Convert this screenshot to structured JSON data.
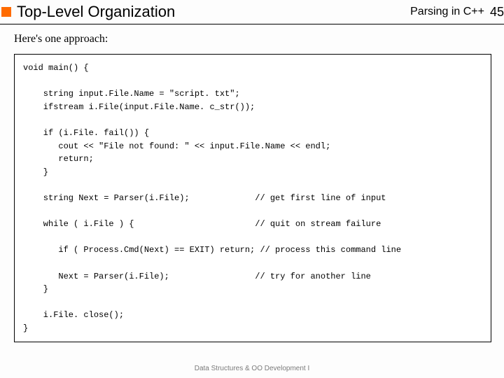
{
  "header": {
    "title": "Top-Level Organization",
    "subtitle": "Parsing in C++",
    "page": "45"
  },
  "intro": "Here's one approach:",
  "code": "void main() {\n\n    string input.File.Name = \"script. txt\";\n    ifstream i.File(input.File.Name. c_str());\n\n    if (i.File. fail()) {\n       cout << \"File not found: \" << input.File.Name << endl;\n       return;\n    }\n\n    string Next = Parser(i.File);             // get first line of input\n\n    while ( i.File ) {                        // quit on stream failure\n\n       if ( Process.Cmd(Next) == EXIT) return; // process this command line\n\n       Next = Parser(i.File);                 // try for another line\n    }\n\n    i.File. close();\n}",
  "footer": "Data Structures & OO Development I"
}
